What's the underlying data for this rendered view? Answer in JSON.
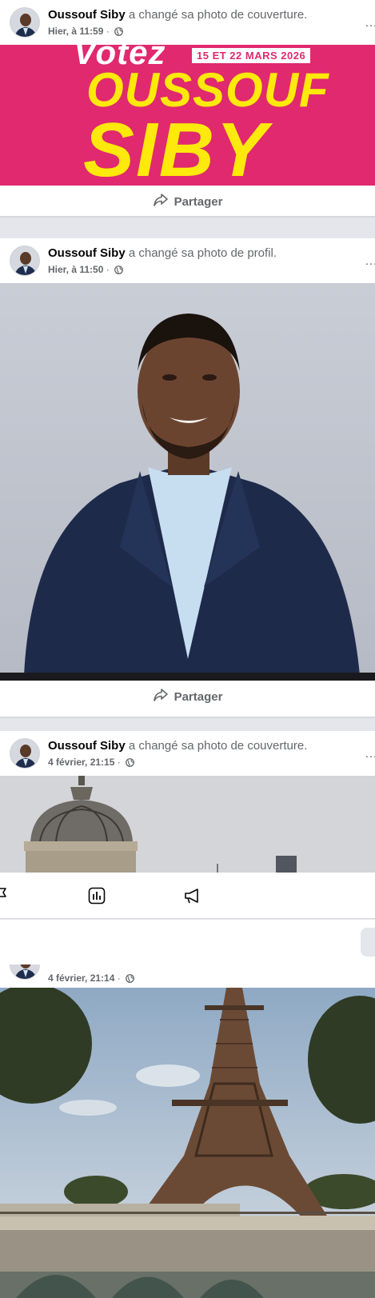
{
  "posts": [
    {
      "author": "Oussouf Siby",
      "action": "a changé sa photo de couverture.",
      "time": "Hier, à 11:59",
      "share_label": "Partager",
      "banner": {
        "line1": "Votez",
        "dates": "15 ET 22 MARS 2026",
        "line2": "OUSSOUF",
        "line3": "SIBY"
      }
    },
    {
      "author": "Oussouf Siby",
      "action": "a changé sa photo de profil.",
      "time": "Hier, à 11:50",
      "share_label": "Partager"
    },
    {
      "author": "Oussouf Siby",
      "action": "a changé sa photo de couverture.",
      "time": "4 février, 21:15"
    },
    {
      "time": "4 février, 21:14"
    }
  ],
  "separator": "·",
  "more_icon": "…",
  "icons": {
    "flag": "flag-icon",
    "insights": "insights-icon",
    "promote": "megaphone-icon",
    "globe": "globe-icon",
    "share": "share-icon"
  },
  "colors": {
    "banner_pink": "#e0296e",
    "banner_yellow": "#fde90b",
    "secondary_text": "#65676b"
  }
}
